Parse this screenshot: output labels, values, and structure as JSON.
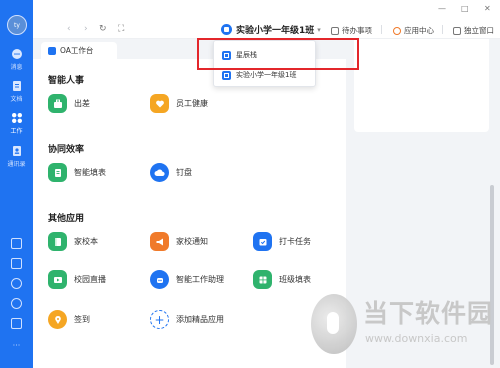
{
  "rail": {
    "avatar_text": "ty",
    "items": [
      {
        "label": "消息",
        "icon": "chat-icon"
      },
      {
        "label": "文档",
        "icon": "document-icon"
      },
      {
        "label": "工作",
        "icon": "apps-icon",
        "active": true
      },
      {
        "label": "通讯录",
        "icon": "contacts-icon"
      }
    ],
    "bottom_icons": [
      "grid-icon",
      "check-icon",
      "flash-icon",
      "phone-icon",
      "mail-icon",
      "more-icon"
    ]
  },
  "topbar": {
    "back": "‹",
    "forward": "›",
    "refresh": "↻",
    "fullscreen": "⛶",
    "group_name": "实验小学一年级1班",
    "caret": "▾",
    "actions": [
      "待办事项",
      "应用中心",
      "独立窗口"
    ],
    "win_controls": [
      "—",
      "□",
      "✕"
    ]
  },
  "tab": {
    "label": "OA工作台"
  },
  "dropdown": {
    "items": [
      "星辰栈",
      "实验小学一年级1班"
    ]
  },
  "sections": [
    {
      "title": "智能人事",
      "apps": [
        {
          "label": "出差",
          "icon": "briefcase-icon",
          "color": "#2fb36d"
        },
        {
          "label": "员工健康",
          "icon": "heart-icon",
          "color": "#f5a623"
        }
      ]
    },
    {
      "title": "协同效率",
      "apps": [
        {
          "label": "智能填表",
          "icon": "form-icon",
          "color": "#2fb36d"
        },
        {
          "label": "钉盘",
          "icon": "cloud-icon",
          "color": "#1f73f1"
        }
      ]
    },
    {
      "title": "其他应用",
      "apps": [
        {
          "label": "家校本",
          "icon": "notebook-icon",
          "color": "#2fb36d"
        },
        {
          "label": "家校通知",
          "icon": "megaphone-icon",
          "color": "#f07a2a"
        },
        {
          "label": "打卡任务",
          "icon": "calendar-icon",
          "color": "#1f73f1"
        },
        {
          "label": "校园直播",
          "icon": "broadcast-icon",
          "color": "#2fb36d"
        },
        {
          "label": "智能工作助理",
          "icon": "robot-icon",
          "color": "#1f73f1"
        },
        {
          "label": "班级填表",
          "icon": "table-icon",
          "color": "#2fb36d"
        },
        {
          "label": "签到",
          "icon": "location-icon",
          "color": "#f5a623"
        },
        {
          "label": "添加精品应用",
          "icon": "plus-icon",
          "color": "#1f73f1"
        }
      ]
    }
  ],
  "watermark": {
    "title": "当下软件园",
    "url": "www.downxia.com"
  }
}
